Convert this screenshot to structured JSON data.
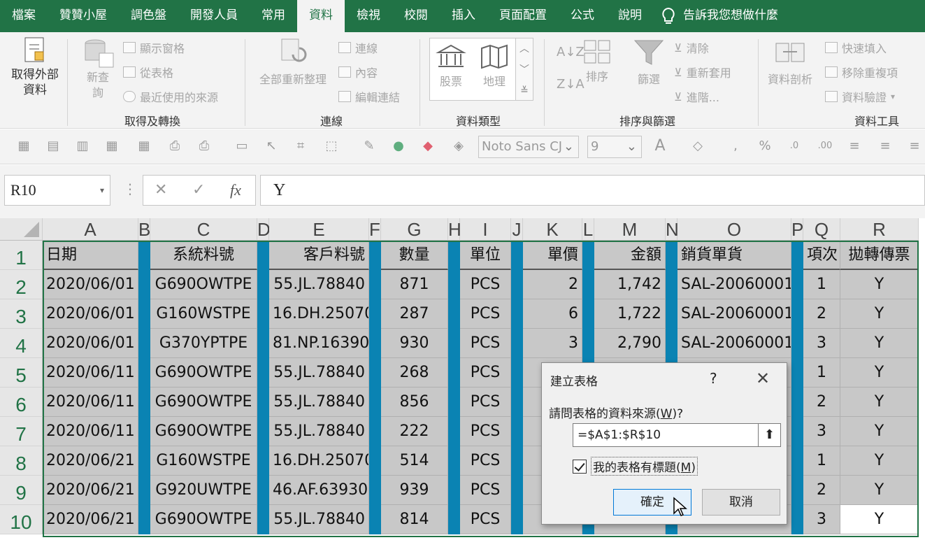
{
  "menubar": {
    "items": [
      {
        "label": "檔案",
        "active": false
      },
      {
        "label": "贊贊小屋",
        "active": false
      },
      {
        "label": "調色盤",
        "active": false
      },
      {
        "label": "開發人員",
        "active": false
      },
      {
        "label": "常用",
        "active": false
      },
      {
        "label": "資料",
        "active": true
      },
      {
        "label": "檢視",
        "active": false
      },
      {
        "label": "校閱",
        "active": false
      },
      {
        "label": "插入",
        "active": false
      },
      {
        "label": "頁面配置",
        "active": false
      },
      {
        "label": "公式",
        "active": false
      },
      {
        "label": "說明",
        "active": false
      }
    ],
    "tell_me": "告訴我您想做什麼"
  },
  "ribbon": {
    "get_external": "取得外部\n資料",
    "new_query": "新查\n詢",
    "show_queries": "顯示窗格",
    "from_table": "從表格",
    "recent_sources": "最近使用的來源",
    "group_get_transform": "取得及轉換",
    "refresh_all": "全部重新整理",
    "connections": "連線",
    "properties": "內容",
    "edit_links": "編輯連結",
    "group_connections": "連線",
    "stocks": "股票",
    "geography": "地理",
    "group_data_types": "資料類型",
    "sort": "排序",
    "filter": "篩選",
    "clear": "清除",
    "reapply": "重新套用",
    "advanced": "進階...",
    "group_sort_filter": "排序與篩選",
    "text_to_columns": "資料剖析",
    "flash_fill": "快速填入",
    "remove_duplicates": "移除重複項",
    "data_validation": "資料驗證",
    "group_data_tools": "資料工具"
  },
  "toolbar2": {
    "font_name": "Noto Sans CJ",
    "font_size": "9"
  },
  "formula_bar": {
    "name_box": "R10",
    "content": "Y",
    "fx": "fx"
  },
  "columns": [
    "A",
    "B",
    "C",
    "D",
    "E",
    "F",
    "G",
    "H",
    "I",
    "J",
    "K",
    "L",
    "M",
    "N",
    "O",
    "P",
    "Q",
    "R"
  ],
  "row_numbers": [
    "1",
    "2",
    "3",
    "4",
    "5",
    "6",
    "7",
    "8",
    "9",
    "10"
  ],
  "header_row": {
    "A": "日期",
    "C": "系統料號",
    "E": "客戶料號",
    "G": "數量",
    "I": "單位",
    "K": "單價",
    "M": "金額",
    "O": "銷貨單貨",
    "Q": "項次",
    "R": "拋轉傳票"
  },
  "rows": [
    {
      "A": "2020/06/01",
      "C": "G690OWTPE",
      "E": "55.JL.78840",
      "G": "871",
      "I": "PCS",
      "K": "2",
      "M": "1,742",
      "O": "SAL-20060001",
      "Q": "1",
      "R": "Y"
    },
    {
      "A": "2020/06/01",
      "C": "G160WSTPE",
      "E": "16.DH.25070",
      "G": "287",
      "I": "PCS",
      "K": "6",
      "M": "1,722",
      "O": "SAL-20060001",
      "Q": "2",
      "R": "Y"
    },
    {
      "A": "2020/06/01",
      "C": "G370YPTPE",
      "E": "81.NP.16390",
      "G": "930",
      "I": "PCS",
      "K": "3",
      "M": "2,790",
      "O": "SAL-20060001",
      "Q": "3",
      "R": "Y"
    },
    {
      "A": "2020/06/11",
      "C": "G690OWTPE",
      "E": "55.JL.78840",
      "G": "268",
      "I": "PCS",
      "K": "",
      "M": "",
      "O": "",
      "Q": "1",
      "R": "Y"
    },
    {
      "A": "2020/06/11",
      "C": "G690OWTPE",
      "E": "55.JL.78840",
      "G": "856",
      "I": "PCS",
      "K": "",
      "M": "",
      "O": "",
      "Q": "2",
      "R": "Y"
    },
    {
      "A": "2020/06/11",
      "C": "G690OWTPE",
      "E": "55.JL.78840",
      "G": "222",
      "I": "PCS",
      "K": "",
      "M": "",
      "O": "",
      "Q": "3",
      "R": "Y"
    },
    {
      "A": "2020/06/21",
      "C": "G160WSTPE",
      "E": "16.DH.25070",
      "G": "514",
      "I": "PCS",
      "K": "",
      "M": "",
      "O": "",
      "Q": "1",
      "R": "Y"
    },
    {
      "A": "2020/06/21",
      "C": "G920UWTPE",
      "E": "46.AF.63930",
      "G": "939",
      "I": "PCS",
      "K": "",
      "M": "",
      "O": "",
      "Q": "2",
      "R": "Y"
    },
    {
      "A": "2020/06/21",
      "C": "G690OWTPE",
      "E": "55.JL.78840",
      "G": "814",
      "I": "PCS",
      "K": "",
      "M": "",
      "O": "",
      "Q": "3",
      "R": "Y"
    }
  ],
  "dialog": {
    "title": "建立表格",
    "help": "?",
    "prompt_pre": "請問表格的資料來源(",
    "prompt_key": "W",
    "prompt_post": ")?",
    "range": "=$A$1:$R$10",
    "has_headers_pre": "我的表格有標題(",
    "has_headers_key": "M",
    "has_headers_post": ")",
    "has_headers_checked": true,
    "ok": "確定",
    "cancel": "取消"
  },
  "colors": {
    "excel_green": "#217346",
    "spacer_blue": "#0a83b3",
    "cell_gray": "#c8c8c8"
  }
}
